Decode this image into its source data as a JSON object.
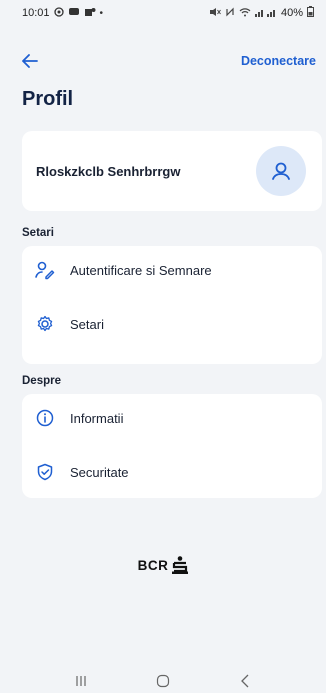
{
  "status_bar": {
    "time": "10:01",
    "left_icons": [
      "whatsapp-icon",
      "messenger-icon",
      "teams-icon",
      "dot-icon"
    ],
    "battery": "40%"
  },
  "header": {
    "logout_label": "Deconectare"
  },
  "page": {
    "title": "Profil"
  },
  "profile": {
    "name": "Rloskzkclb Senhrbrrgw"
  },
  "sections": {
    "settings_label": "Setari",
    "about_label": "Despre"
  },
  "settings_items": [
    {
      "label": "Autentificare si Semnare",
      "icon": "user-key-icon"
    },
    {
      "label": "Setari",
      "icon": "gear-icon"
    }
  ],
  "about_items": [
    {
      "label": "Informatii",
      "icon": "info-icon"
    },
    {
      "label": "Securitate",
      "icon": "shield-check-icon"
    }
  ],
  "brand": {
    "text": "BCR"
  },
  "colors": {
    "accent": "#1f5fd1",
    "background": "#f2f4f7",
    "card": "#ffffff",
    "avatar_bg": "#dde8f8",
    "title": "#132345"
  }
}
